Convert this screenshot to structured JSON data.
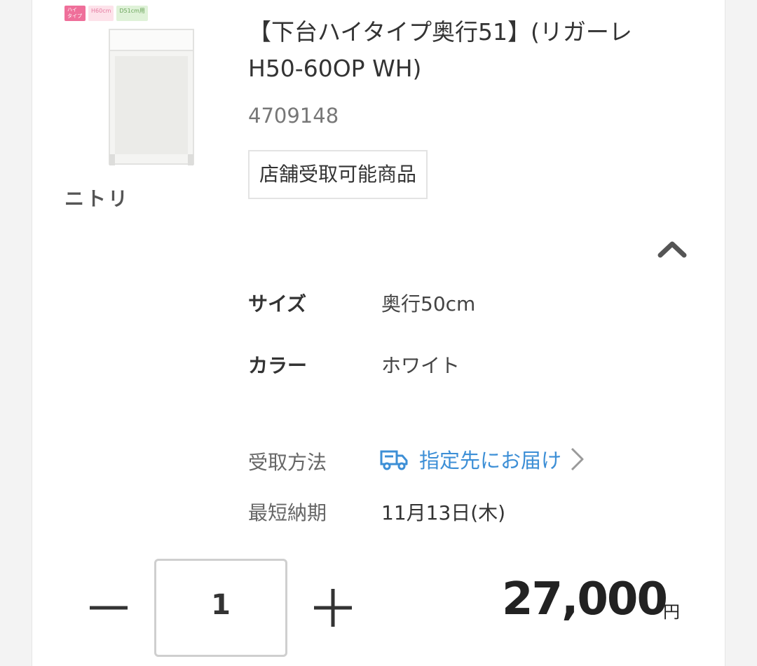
{
  "product": {
    "title": "【下台ハイタイプ奥行51】(リガーレ H50-60OP WH)",
    "sku": "4709148",
    "brand": "ニトリ",
    "pickup_tag": "店舗受取可能商品",
    "thumbnail_badges": {
      "type": "ハイ タイプ",
      "height": "H60cm",
      "depth": "D51cm用"
    }
  },
  "specs": {
    "size_label": "サイズ",
    "size_value": "奥行50cm",
    "color_label": "カラー",
    "color_value": "ホワイト"
  },
  "delivery": {
    "method_label": "受取方法",
    "method_value": "指定先にお届け",
    "earliest_label": "最短納期",
    "earliest_value": "11月13日(木)"
  },
  "purchase": {
    "quantity": "1",
    "price": "27,000",
    "currency": "円"
  },
  "colors": {
    "link": "#3d8fd6",
    "text": "#333333",
    "border": "#e3e3e3"
  },
  "icons": [
    "chevron-up-icon",
    "truck-icon",
    "chevron-right-icon",
    "minus-icon",
    "plus-icon"
  ]
}
